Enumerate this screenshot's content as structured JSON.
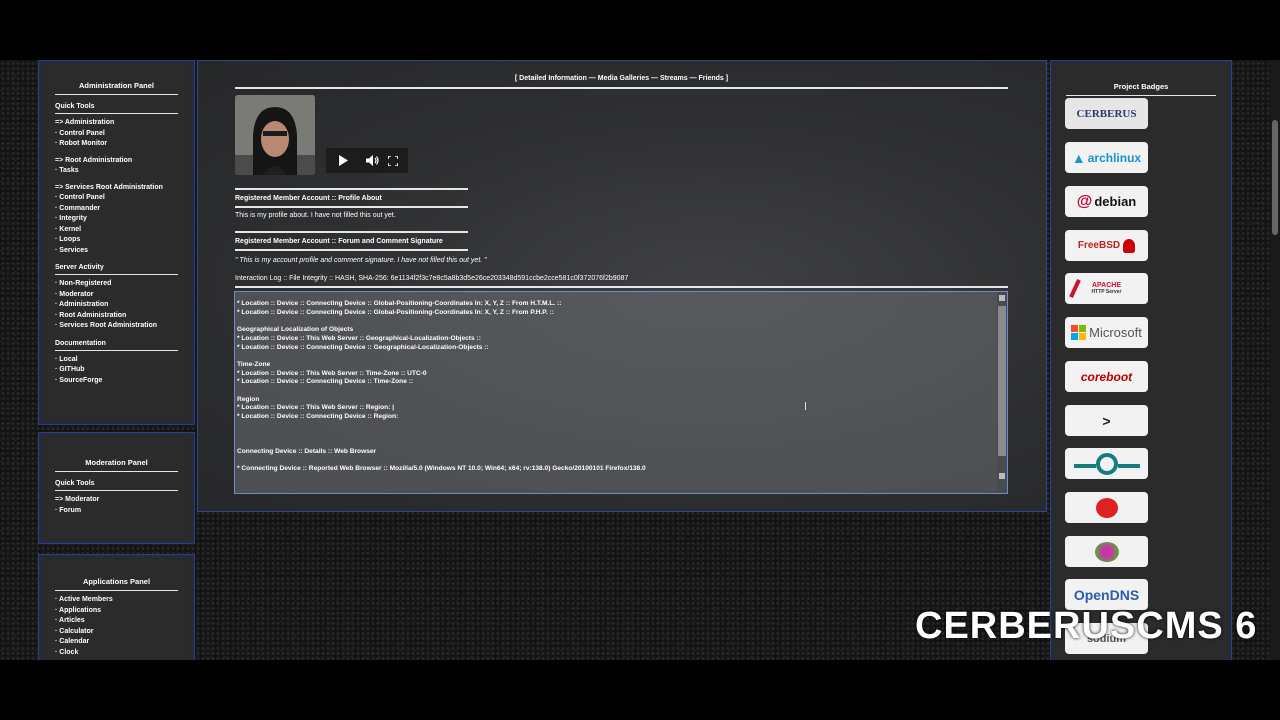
{
  "admin_panel": {
    "title": "Administration Panel",
    "quick_tools": "Quick Tools",
    "group1": [
      "=> Administration",
      "· Control Panel",
      "· Robot Monitor"
    ],
    "group2": [
      "=> Root Administration",
      "· Tasks"
    ],
    "group3": [
      "=> Services Root Administration",
      "· Control Panel",
      "· Commander",
      "· Integrity",
      "· Kernel",
      "· Loops",
      "· Services"
    ],
    "server_activity": "Server Activity",
    "activity": [
      "· Non-Registered",
      "· Moderator",
      "· Administration",
      "· Root Administration",
      "· Services Root Administration"
    ],
    "documentation": "Documentation",
    "docs": [
      "· Local",
      "· GITHub",
      "· SourceForge"
    ]
  },
  "moderation_panel": {
    "title": "Moderation Panel",
    "quick_tools": "Quick Tools",
    "items": [
      "=> Moderator",
      "· Forum"
    ]
  },
  "applications_panel": {
    "title": "Applications Panel",
    "items": [
      "· Active Members",
      "· Applications",
      "· Articles",
      "· Calculator",
      "· Calendar",
      "· Clock"
    ]
  },
  "main": {
    "nav": "[  Detailed Information — Media Galleries — Streams — Friends  ]",
    "profile_about_title": "Registered Member Account :: Profile About",
    "profile_about_text": "This is my profile about. I have not filled this out yet.",
    "signature_title": "Registered Member Account :: Forum and Comment Signature",
    "signature_text": "\"  This is my account profile and comment signature. I have not filled this out yet.  \"",
    "integrity": "Interaction Log :: File Integrity :: HASH, SHA-256: 6e1134f2f3c7e8c5a8b3d5e26ce203348d591ccbe2cce581c0f372076f2b9087",
    "log_lines": [
      "* Location :: Device :: Connecting Device :: Global-Positioning-Coordinates In: X, Y, Z :: From H.T.M.L. ::",
      "* Location :: Device :: Connecting Device :: Global-Positioning-Coordinates In: X, Y, Z :: From P.H.P. ::",
      "",
      "Geographical Localization of Objects",
      "* Location :: Device :: This Web Server :: Geographical-Localization-Objects ::",
      "* Location :: Device :: Connecting Device :: Geographical-Localization-Objects ::",
      "",
      "Time-Zone",
      "* Location :: Device :: This Web Server :: Time-Zone :: UTC-0",
      "* Location :: Device :: Connecting Device :: Time-Zone ::",
      "",
      "Region",
      "* Location :: Device :: This Web Server :: Region: |",
      "* Location :: Device :: Connecting Device :: Region:",
      "",
      "",
      "",
      "Connecting Device :: Details :: Web Browser",
      "",
      "* Connecting Device :: Reported Web Browser :: Mozilla/5.0 (Windows NT 10.0; Win64; x64; rv:138.0) Gecko/20100101 Firefox/138.0"
    ]
  },
  "badges": {
    "title": "Project Badges",
    "items": [
      "CERBERUS",
      "archlinux",
      "debian",
      "FreeBSD",
      "APACHE",
      "HTTP Server",
      "Microsoft",
      "coreboot",
      "OpenDNS",
      "sodium"
    ]
  },
  "overlay": "CERBERUSCMS 6",
  "colors": {
    "panel": "#2b2b2b",
    "border": "#2f3f7a",
    "accent": "#6f8ad0"
  }
}
